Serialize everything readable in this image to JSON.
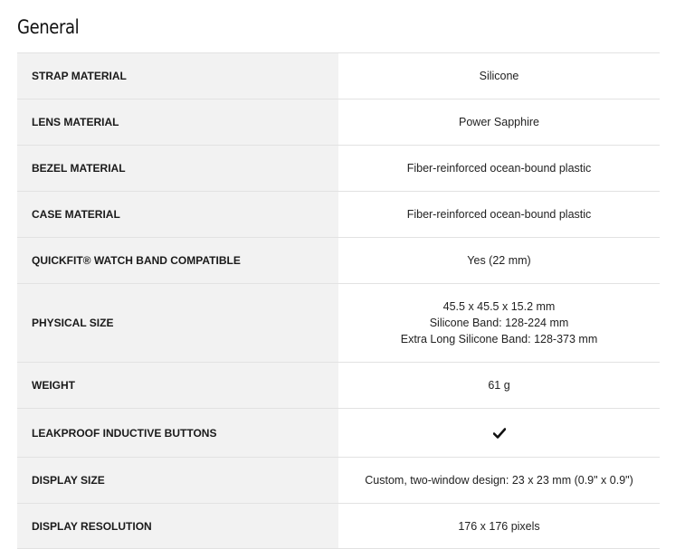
{
  "section": {
    "title": "General"
  },
  "specs": [
    {
      "label": "STRAP MATERIAL",
      "value": "Silicone"
    },
    {
      "label": "LENS MATERIAL",
      "value": "Power Sapphire"
    },
    {
      "label": "BEZEL MATERIAL",
      "value": "Fiber-reinforced ocean-bound plastic"
    },
    {
      "label": "CASE MATERIAL",
      "value": "Fiber-reinforced ocean-bound plastic"
    },
    {
      "label": "QUICKFIT® WATCH BAND COMPATIBLE",
      "value": "Yes (22 mm)"
    },
    {
      "label": "PHYSICAL SIZE",
      "lines": [
        "45.5 x 45.5 x 15.2 mm",
        "Silicone Band: 128-224 mm",
        "Extra Long Silicone Band: 128-373 mm"
      ]
    },
    {
      "label": "WEIGHT",
      "value": "61 g"
    },
    {
      "label": "LEAKPROOF INDUCTIVE BUTTONS",
      "icon": "checkmark-icon"
    },
    {
      "label": "DISPLAY SIZE",
      "value": "Custom, two-window design: 23 x 23 mm (0.9\" x 0.9\")"
    },
    {
      "label": "DISPLAY RESOLUTION",
      "value": "176 x 176 pixels"
    }
  ]
}
